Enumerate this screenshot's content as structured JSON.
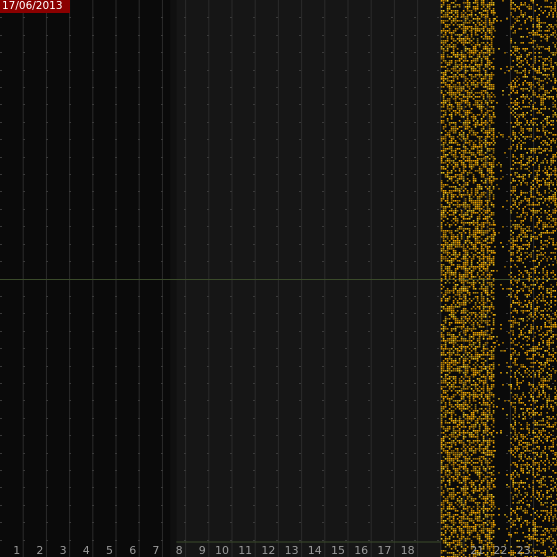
{
  "date_label": "17/06/2013",
  "chart_data": {
    "type": "heatmap",
    "title": "",
    "xlabel": "",
    "ylabel": "",
    "date": "17/06/2013",
    "x_ticks": [
      "1",
      "2",
      "3",
      "4",
      "5",
      "6",
      "7",
      "8",
      "9",
      "10",
      "11",
      "12",
      "13",
      "14",
      "15",
      "16",
      "17",
      "18",
      "21",
      "22",
      "23"
    ],
    "xlim": [
      0,
      24
    ],
    "grid": true,
    "legend": "none",
    "colors": {
      "background": "#0a0a0a",
      "shaded_region": "#161616",
      "grid_major": "#2b2b2b",
      "grid_minor": "#3a3a3a",
      "midline": "#3a4a2a",
      "detection": "#ffb000",
      "detection_bright": "#ffd21f",
      "date_badge": "#8b0000"
    },
    "shaded_region": {
      "start_hour": 7.6,
      "end_hour": 19
    },
    "activity_bands": [
      {
        "start_hour": 19.0,
        "end_hour": 21.3,
        "intensity": "high"
      },
      {
        "start_hour": 21.3,
        "end_hour": 22.0,
        "intensity": "low"
      },
      {
        "start_hour": 22.0,
        "end_hour": 24.0,
        "intensity": "medium"
      }
    ]
  }
}
